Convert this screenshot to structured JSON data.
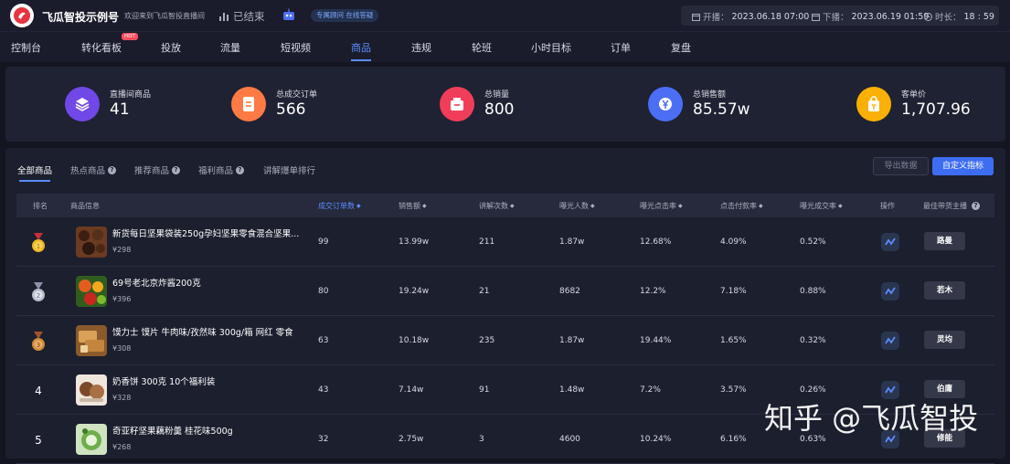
{
  "header": {
    "brand": "飞瓜智投示例号",
    "welcome": "欢迎来到飞瓜智投直播间",
    "status": "已结束",
    "pill": "专属顾问 在线答疑",
    "start_label": "开播：",
    "start_value": "2023.06.18 07:00",
    "end_label": "下播：",
    "end_value": "2023.06.19 01:59",
    "duration_label": "时长：",
    "duration_value": "18 : 59"
  },
  "nav": {
    "items": [
      "控制台",
      "转化看板",
      "投放",
      "流量",
      "短视频",
      "商品",
      "违规",
      "轮班",
      "小时目标",
      "订单",
      "复盘"
    ],
    "active": "商品",
    "hot_badge": "HOT"
  },
  "stats": [
    {
      "label": "直播间商品",
      "value": "41",
      "color": "#7048e8",
      "icon": "layers-icon"
    },
    {
      "label": "总成交订单",
      "value": "566",
      "color": "#ff7a45",
      "icon": "document-icon"
    },
    {
      "label": "总销量",
      "value": "800",
      "color": "#f03e5a",
      "icon": "box-icon"
    },
    {
      "label": "总销售额",
      "value": "85.57w",
      "color": "#4c6ef5",
      "icon": "yen-icon"
    },
    {
      "label": "客单价",
      "value": "1,707.96",
      "color": "#fab005",
      "icon": "bag-icon"
    }
  ],
  "tabs": [
    {
      "label": "全部商品",
      "help": false
    },
    {
      "label": "热点商品",
      "help": true
    },
    {
      "label": "推荐商品",
      "help": true
    },
    {
      "label": "福利商品",
      "help": true
    },
    {
      "label": "讲解爆单排行",
      "help": false
    }
  ],
  "buttons": {
    "export": "导出数据",
    "custom": "自定义指标"
  },
  "table": {
    "headers": [
      "排名",
      "商品信息",
      "成交订单数",
      "销售额",
      "讲解次数",
      "曝光人数",
      "曝光点击率",
      "点击付款率",
      "曝光成交率",
      "操作",
      "最佳带货主播"
    ],
    "rows": [
      {
        "rank": "1",
        "medal": "gold",
        "name": "新货每日坚果袋装250g孕妇坚果零食混合坚果...",
        "price": "¥298",
        "orders": "99",
        "sales": "13.99w",
        "explains": "211",
        "exposure": "1.87w",
        "ctr": "12.68%",
        "pay_rate": "4.09%",
        "conv": "0.52%",
        "host": "路曼"
      },
      {
        "rank": "2",
        "medal": "silver",
        "name": "69号老北京炸酱200克",
        "price": "¥396",
        "orders": "80",
        "sales": "19.24w",
        "explains": "21",
        "exposure": "8682",
        "ctr": "12.2%",
        "pay_rate": "7.18%",
        "conv": "0.88%",
        "host": "若木"
      },
      {
        "rank": "3",
        "medal": "bronze",
        "name": "馍力士 馍片 牛肉味/孜然味 300g/箱 网红 零食",
        "price": "¥308",
        "orders": "63",
        "sales": "10.18w",
        "explains": "235",
        "exposure": "1.87w",
        "ctr": "19.44%",
        "pay_rate": "1.65%",
        "conv": "0.32%",
        "host": "灵均"
      },
      {
        "rank": "4",
        "medal": "",
        "name": "奶香饼 300克 10个福利装",
        "price": "¥328",
        "orders": "43",
        "sales": "7.14w",
        "explains": "91",
        "exposure": "1.48w",
        "ctr": "7.2%",
        "pay_rate": "3.57%",
        "conv": "0.26%",
        "host": "伯庸"
      },
      {
        "rank": "5",
        "medal": "",
        "name": "奇亚籽坚果藕粉羹 桂花味500g",
        "price": "¥268",
        "orders": "32",
        "sales": "2.75w",
        "explains": "3",
        "exposure": "4600",
        "ctr": "10.24%",
        "pay_rate": "6.16%",
        "conv": "0.63%",
        "host": "修能"
      }
    ]
  },
  "watermark": "知乎 @飞瓜智投"
}
